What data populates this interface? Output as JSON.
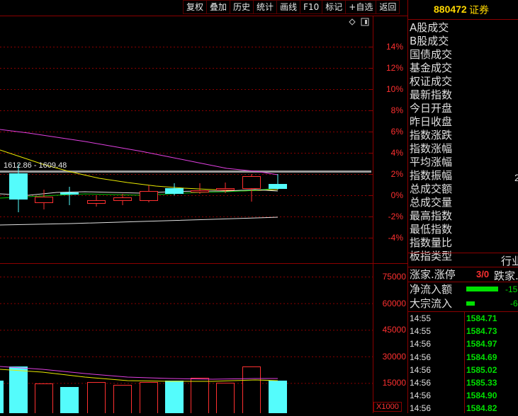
{
  "toolbar": {
    "items": [
      "复权",
      "叠加",
      "历史",
      "统计",
      "画线",
      "F10",
      "标记",
      "+自选",
      "返回"
    ]
  },
  "main_chart": {
    "price_annotation": "1612.86 - 1609.48",
    "pct_scale": [
      "14%",
      "12%",
      "10%",
      "8%",
      "6%",
      "4%",
      "2%",
      "0%",
      "-2%",
      "-4%"
    ]
  },
  "volume_chart": {
    "scale": [
      "75000",
      "60000",
      "45000",
      "30000",
      "15000"
    ],
    "multiplier": "X1000"
  },
  "right_panel": {
    "code": "880472",
    "name": "证券",
    "labels": [
      "A股成交",
      "B股成交",
      "国债成交",
      "基金成交",
      "权证成交",
      "最新指数",
      "今日开盘",
      "昨日收盘",
      "指数涨跌",
      "指数涨幅",
      "平均涨幅",
      "指数振幅",
      "总成交额",
      "总成交量",
      "最高指数",
      "最低指数",
      "指数量比",
      "板指类型"
    ],
    "amplitude_value_partial": "2",
    "board_type_value": "行业",
    "up_stop_label": "涨家.涨停",
    "up_stop_value": "3/0",
    "down_label": "跌家.",
    "net_inflow_label": "净流入额",
    "net_inflow_value": "-15",
    "block_inflow_label": "大宗流入",
    "block_inflow_value": "-6",
    "ticks": [
      {
        "time": "14:55",
        "price": "1584.71"
      },
      {
        "time": "14:55",
        "price": "1584.73"
      },
      {
        "time": "14:56",
        "price": "1584.97"
      },
      {
        "time": "14:56",
        "price": "1584.69"
      },
      {
        "time": "14:56",
        "price": "1585.02"
      },
      {
        "time": "14:56",
        "price": "1585.33"
      },
      {
        "time": "14:56",
        "price": "1584.90"
      },
      {
        "time": "14:56",
        "price": "1584.82"
      }
    ]
  },
  "colors": {
    "up": "#ff3030",
    "down": "#54fcfc",
    "grid": "#8b0000",
    "ma_magenta": "#e040e0",
    "ma_yellow": "#e8e800",
    "ma_white": "#e0e0e0",
    "ma_green": "#00c000"
  }
}
